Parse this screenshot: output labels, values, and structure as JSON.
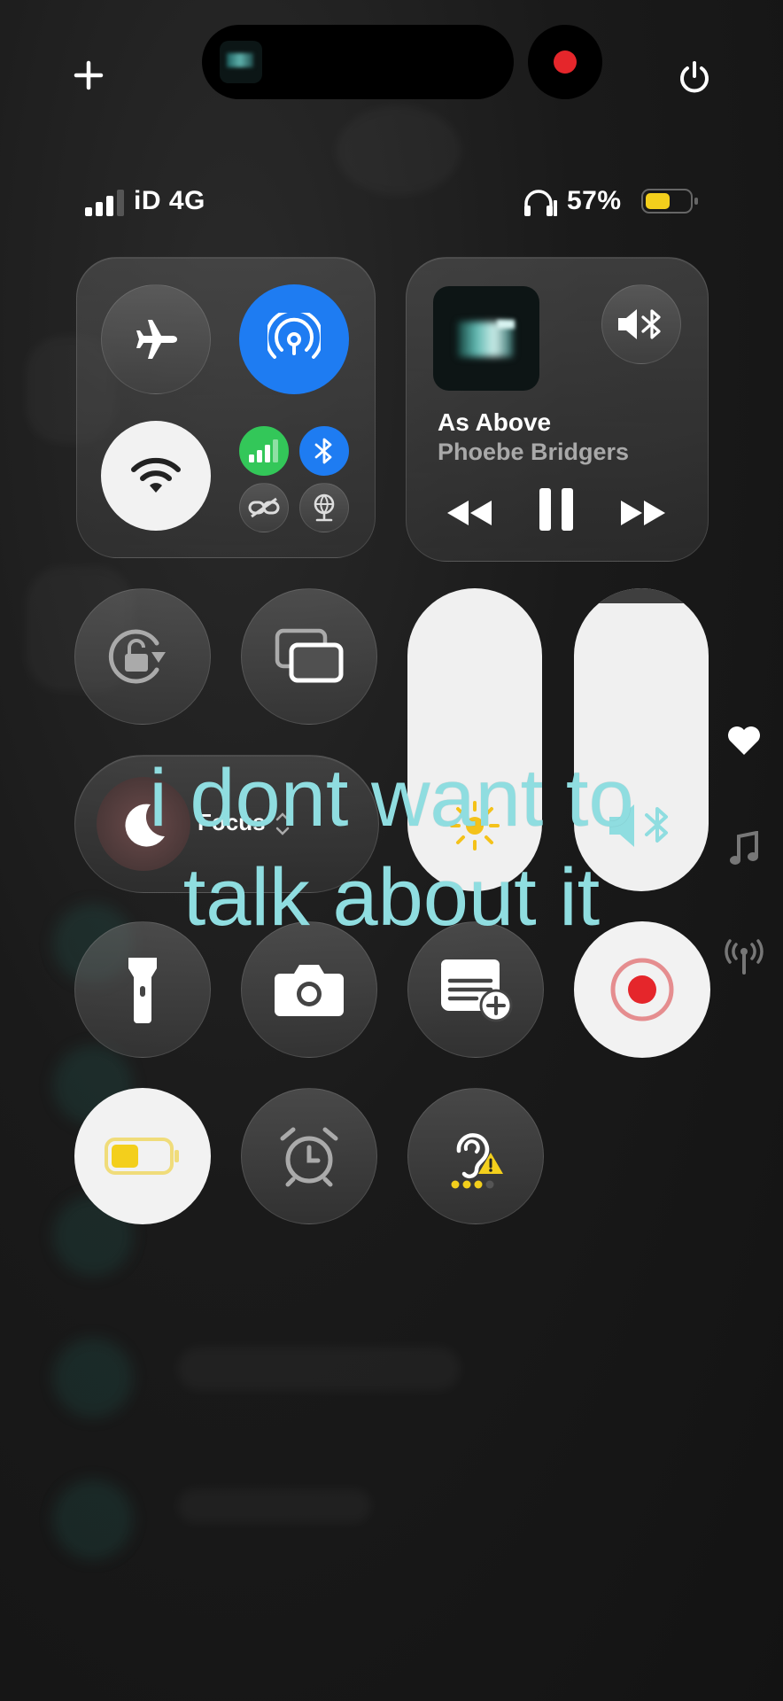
{
  "status_bar": {
    "carrier": "iD 4G",
    "battery_percent": "57%",
    "battery_level": 0.57,
    "battery_color": "#f3cf1c"
  },
  "connectivity": {
    "airplane_icon": "airplane-icon",
    "airdrop_icon": "airdrop-icon",
    "wifi_icon": "wifi-icon",
    "cellular_icon": "cellular-icon",
    "bluetooth_icon": "bluetooth-icon",
    "hotspot_icon": "personal-hotspot-icon",
    "vpn_icon": "vpn-icon",
    "accent_blue": "#1e7cf2",
    "accent_green": "#33c759"
  },
  "now_playing": {
    "title": "As Above",
    "artist": "Phoebe Bridgers"
  },
  "focus": {
    "label": "Focus"
  },
  "sliders": {
    "brightness_level": 1.0,
    "volume_level": 0.95
  },
  "caption": {
    "line1": "i dont want to",
    "line2": "talk about it"
  },
  "colors": {
    "record_red": "#e5262b",
    "caption": "#8fdde0"
  }
}
